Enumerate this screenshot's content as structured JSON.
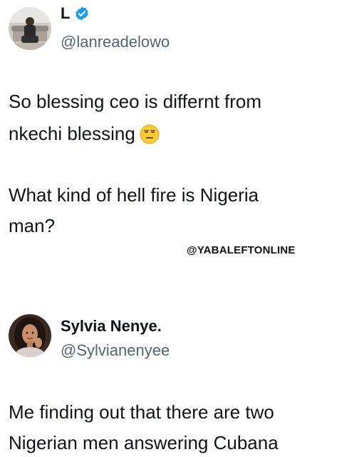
{
  "tweet1": {
    "name": "L",
    "handle": "@lanreadelowo",
    "lines": [
      "So blessing ceo is differnt from",
      "nkechi blessing",
      "What kind of hell fire is Nigeria",
      "man?"
    ],
    "verified": true,
    "emoji": "expressionless-face-emoji"
  },
  "watermark": "@YABALEFTONLINE",
  "tweet2": {
    "name": "Sylvia Nenye.",
    "handle": "@Sylvianenyee",
    "lines": [
      "Me finding out that there are two",
      "Nigerian men answering Cubana"
    ]
  },
  "colors": {
    "text": "#0f1419",
    "handle": "#536471",
    "verified": "#1d9bf0"
  }
}
